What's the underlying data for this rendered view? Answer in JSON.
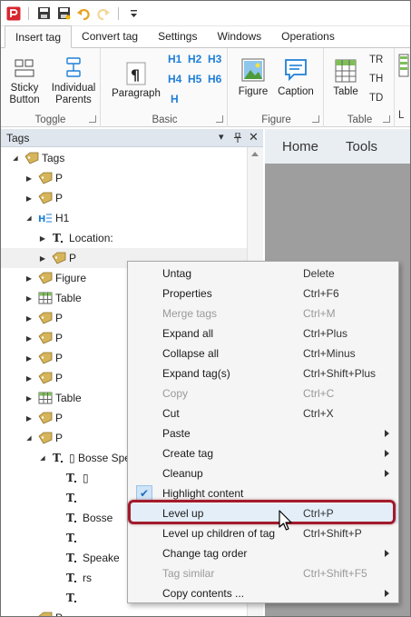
{
  "quick_access": {
    "app_icon": "app-logo-icon",
    "items": [
      "save-icon",
      "save-as-icon",
      "undo-icon",
      "redo-icon",
      "customize-dropdown-icon"
    ]
  },
  "ribbon_tabs": [
    "Insert tag",
    "Convert tag",
    "Settings",
    "Windows",
    "Operations"
  ],
  "ribbon": {
    "toggle": {
      "label": "Toggle",
      "sticky": "Sticky\nButton",
      "individual": "Individual\nParents"
    },
    "basic": {
      "label": "Basic",
      "paragraph": "Paragraph",
      "headings": [
        "H1",
        "H2",
        "H3",
        "H4",
        "H5",
        "H6",
        "H"
      ]
    },
    "figure": {
      "label": "Figure",
      "figure": "Figure",
      "caption": "Caption"
    },
    "table": {
      "label": "Table",
      "table": "Table",
      "tr": "TR",
      "th": "TH",
      "td": "TD"
    },
    "partial": "L"
  },
  "tags_panel": {
    "title": "Tags",
    "tree": [
      {
        "label": "Tags",
        "icon": "tag-icon",
        "expanded": true
      },
      {
        "label": "P",
        "icon": "tag-icon",
        "expanded": false
      },
      {
        "label": "P",
        "icon": "tag-icon",
        "expanded": false
      },
      {
        "label": "H1",
        "icon": "heading-icon",
        "expanded": true
      },
      {
        "label": "Location:",
        "icon": "text-icon",
        "expanded": false
      },
      {
        "label": "P",
        "icon": "tag-icon",
        "expanded": false,
        "selected": true
      },
      {
        "label": "Figure",
        "icon": "tag-icon",
        "expanded": false
      },
      {
        "label": "Table",
        "icon": "table-icon",
        "expanded": false
      },
      {
        "label": "P",
        "icon": "tag-icon",
        "expanded": false
      },
      {
        "label": "P",
        "icon": "tag-icon",
        "expanded": false
      },
      {
        "label": "P",
        "icon": "tag-icon",
        "expanded": false
      },
      {
        "label": "P",
        "icon": "tag-icon",
        "expanded": false
      },
      {
        "label": "Table",
        "icon": "table-icon",
        "expanded": false
      },
      {
        "label": "P",
        "icon": "tag-icon",
        "expanded": false
      },
      {
        "label": "P",
        "icon": "tag-icon",
        "expanded": true
      },
      {
        "label": "▯ Bosse Spea",
        "icon": "text-icon",
        "expanded": true
      },
      {
        "label": "▯",
        "icon": "text-icon"
      },
      {
        "label": "",
        "icon": "text-icon"
      },
      {
        "label": "Bosse",
        "icon": "text-icon"
      },
      {
        "label": "",
        "icon": "text-icon"
      },
      {
        "label": "Speake",
        "icon": "text-icon"
      },
      {
        "label": "rs",
        "icon": "text-icon"
      },
      {
        "label": "",
        "icon": "text-icon"
      },
      {
        "label": "P",
        "icon": "tag-icon"
      }
    ]
  },
  "right_pane_tabs": [
    "Home",
    "Tools",
    ""
  ],
  "context_menu": [
    {
      "label": "Untag",
      "shortcut": "Delete",
      "disabled": false
    },
    {
      "label": "Properties",
      "shortcut": "Ctrl+F6",
      "disabled": false
    },
    {
      "label": "Merge tags",
      "shortcut": "Ctrl+M",
      "disabled": true
    },
    {
      "label": "Expand all",
      "shortcut": "Ctrl+Plus",
      "disabled": false
    },
    {
      "label": "Collapse all",
      "shortcut": "Ctrl+Minus",
      "disabled": false
    },
    {
      "label": "Expand tag(s)",
      "shortcut": "Ctrl+Shift+Plus",
      "disabled": false
    },
    {
      "label": "Copy",
      "shortcut": "Ctrl+C",
      "disabled": true
    },
    {
      "label": "Cut",
      "shortcut": "Ctrl+X",
      "disabled": false
    },
    {
      "label": "Paste",
      "shortcut": "",
      "disabled": false,
      "submenu": true
    },
    {
      "label": "Create tag",
      "shortcut": "",
      "disabled": false,
      "submenu": true
    },
    {
      "label": "Cleanup",
      "shortcut": "",
      "disabled": false,
      "submenu": true
    },
    {
      "label": "Highlight content",
      "shortcut": "",
      "disabled": false,
      "checked": true
    },
    {
      "label": "Level up",
      "shortcut": "Ctrl+P",
      "disabled": false,
      "highlighted": true
    },
    {
      "label": "Level up children of tag",
      "shortcut": "Ctrl+Shift+P",
      "disabled": false
    },
    {
      "label": "Change tag order",
      "shortcut": "",
      "disabled": false,
      "submenu": true
    },
    {
      "label": "Tag similar",
      "shortcut": "Ctrl+Shift+F5",
      "disabled": true
    },
    {
      "label": "Copy contents ...",
      "shortcut": "",
      "disabled": false,
      "submenu": true
    }
  ],
  "colors": {
    "highlight_border": "#a11b2c",
    "heading_blue": "#1e7fd8",
    "tag_icon": "#c7a24a"
  }
}
